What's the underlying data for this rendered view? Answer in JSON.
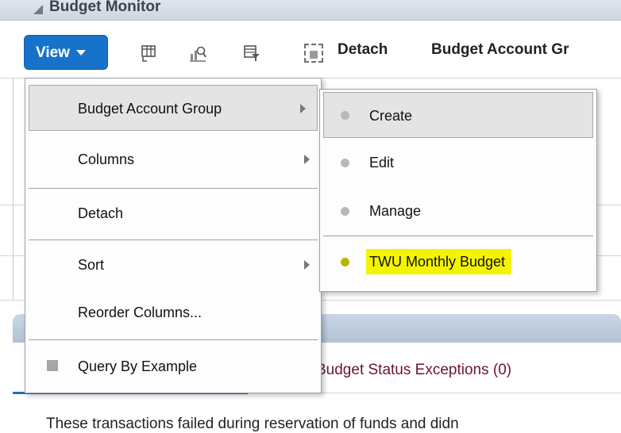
{
  "section": {
    "title": "Budget Monitor"
  },
  "toolbar": {
    "view_label": "View",
    "detach_label": "Detach",
    "budget_account_group_label": "Budget Account Gr"
  },
  "menu": {
    "items": [
      {
        "label": "Budget Account Group",
        "has_submenu": true,
        "highlighted": true
      },
      {
        "label": "Columns",
        "has_submenu": true
      },
      {
        "label": "Detach"
      },
      {
        "label": "Sort",
        "has_submenu": true
      },
      {
        "label": "Reorder Columns..."
      },
      {
        "label": "Query By Example",
        "checkbox": true
      }
    ]
  },
  "submenu": {
    "items": [
      {
        "label": "Create",
        "highlighted": true
      },
      {
        "label": "Edit"
      },
      {
        "label": "Manage"
      },
      {
        "label": "TWU Monthly Budget",
        "marked": true
      }
    ]
  },
  "tabs": {
    "exceptions_label": "Budget Status Exceptions (0)"
  },
  "content": {
    "description": "These transactions failed during reservation of funds and didn"
  },
  "colors": {
    "accent": "#1673c9",
    "highlighter": "#f4f400",
    "exceptions_text": "#6b1530"
  }
}
